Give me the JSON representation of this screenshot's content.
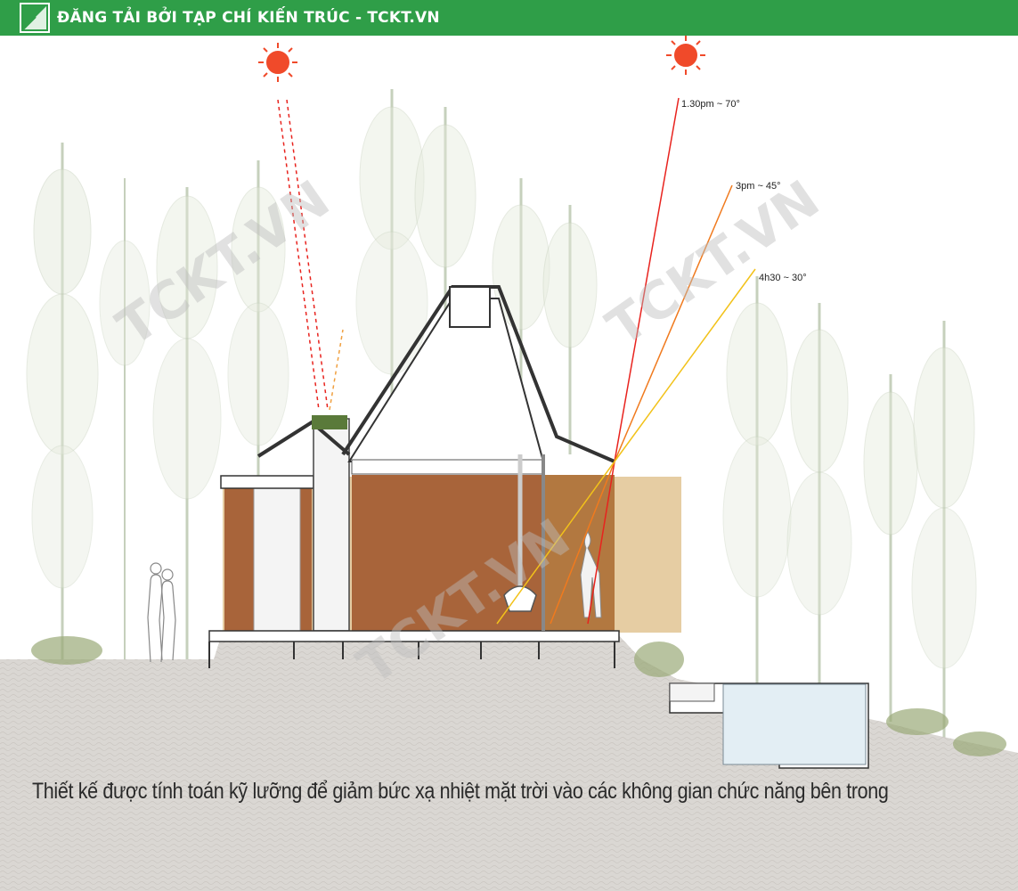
{
  "banner": {
    "text": "ĐĂNG TẢI BỞI TẠP CHÍ KIẾN TRÚC - TCKT.VN",
    "color": "#2f9e48"
  },
  "annotations": {
    "angle_1": "1.30pm ~ 70°",
    "angle_2": "3pm ~ 45°",
    "angle_3": "4h30 ~ 30°"
  },
  "caption": "Thiết kế được tính toán kỹ lưỡng để giảm bức xạ nhiệt mặt trời vào các không gian chức năng bên trong",
  "watermark": "TCKT.VN",
  "colors": {
    "ray_70": "#e8231e",
    "ray_45": "#f07a1e",
    "ray_30": "#f2c21a",
    "sun": "#f04a2a",
    "wall": "#a8643a",
    "ground": "#d9d6d2"
  }
}
